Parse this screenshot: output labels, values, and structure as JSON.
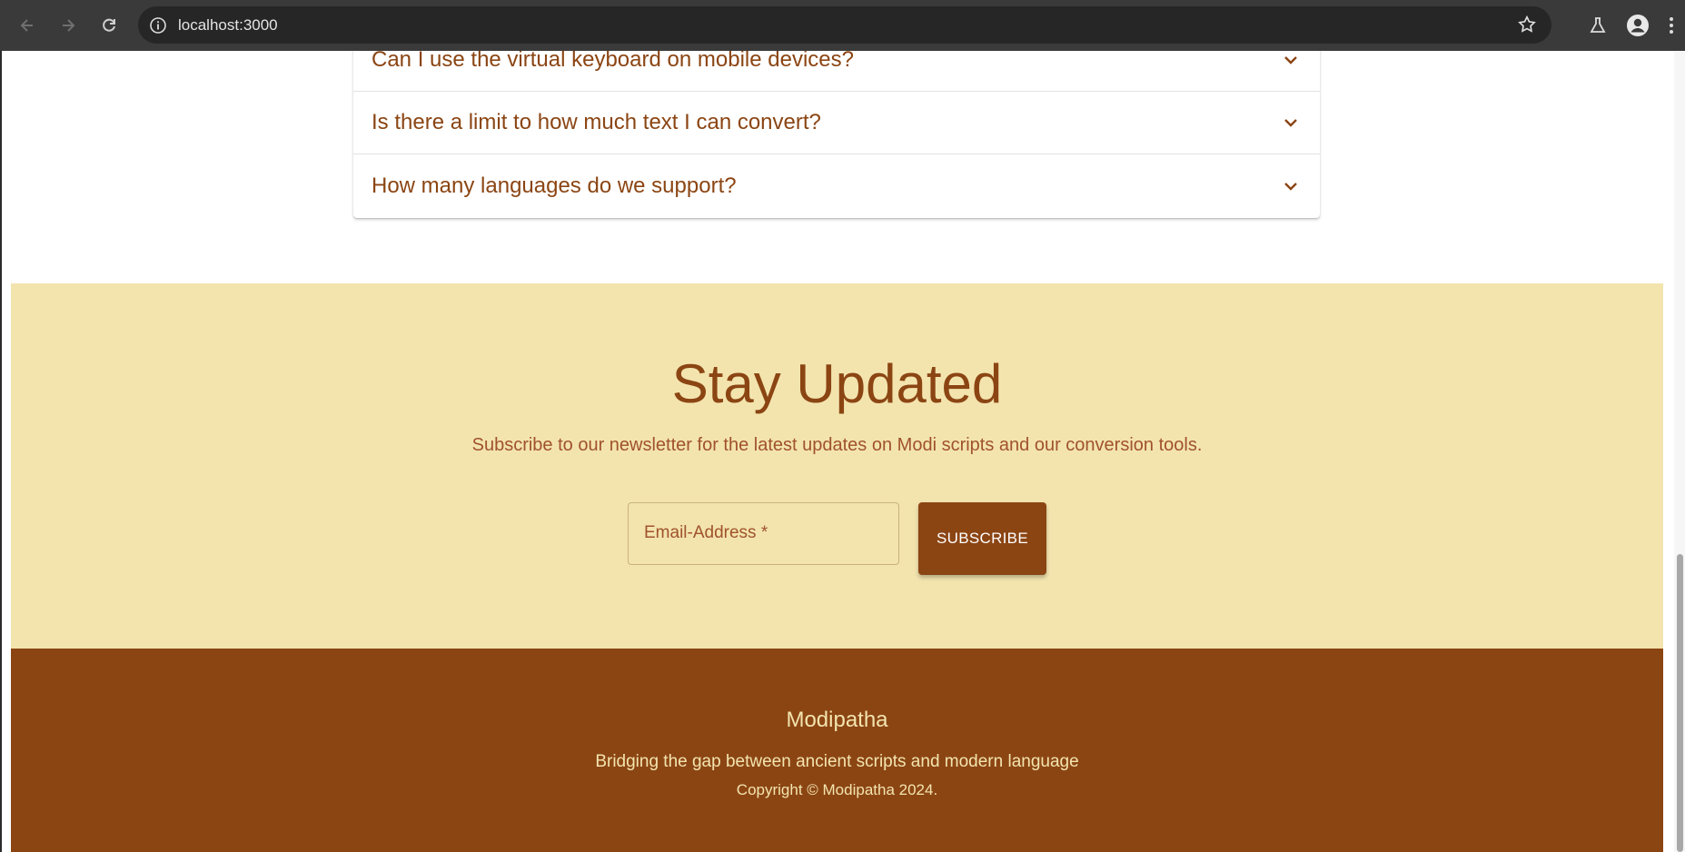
{
  "browser": {
    "url": "localhost:3000",
    "icons": [
      "back-arrow-icon",
      "forward-arrow-icon",
      "reload-icon",
      "site-info-icon",
      "bookmark-star-icon",
      "labs-flask-icon",
      "profile-icon",
      "menu-kebab-icon"
    ]
  },
  "faq": {
    "items": [
      {
        "question": "Can I use the virtual keyboard on mobile devices?"
      },
      {
        "question": "Is there a limit to how much text I can convert?"
      },
      {
        "question": "How many languages do we support?"
      }
    ]
  },
  "newsletter": {
    "title": "Stay Updated",
    "subtitle": "Subscribe to our newsletter for the latest updates on Modi scripts and our conversion tools.",
    "email_placeholder": "Email-Address *",
    "subscribe_label": "SUBSCRIBE"
  },
  "footer": {
    "brand": "Modipatha",
    "tagline": "Bridging the gap between ancient scripts and modern language",
    "copyright": "Copyright © Modipatha 2024."
  },
  "colors": {
    "brand_brown": "#8b4513",
    "cream": "#f3e4ae",
    "sienna": "#a0522d"
  }
}
